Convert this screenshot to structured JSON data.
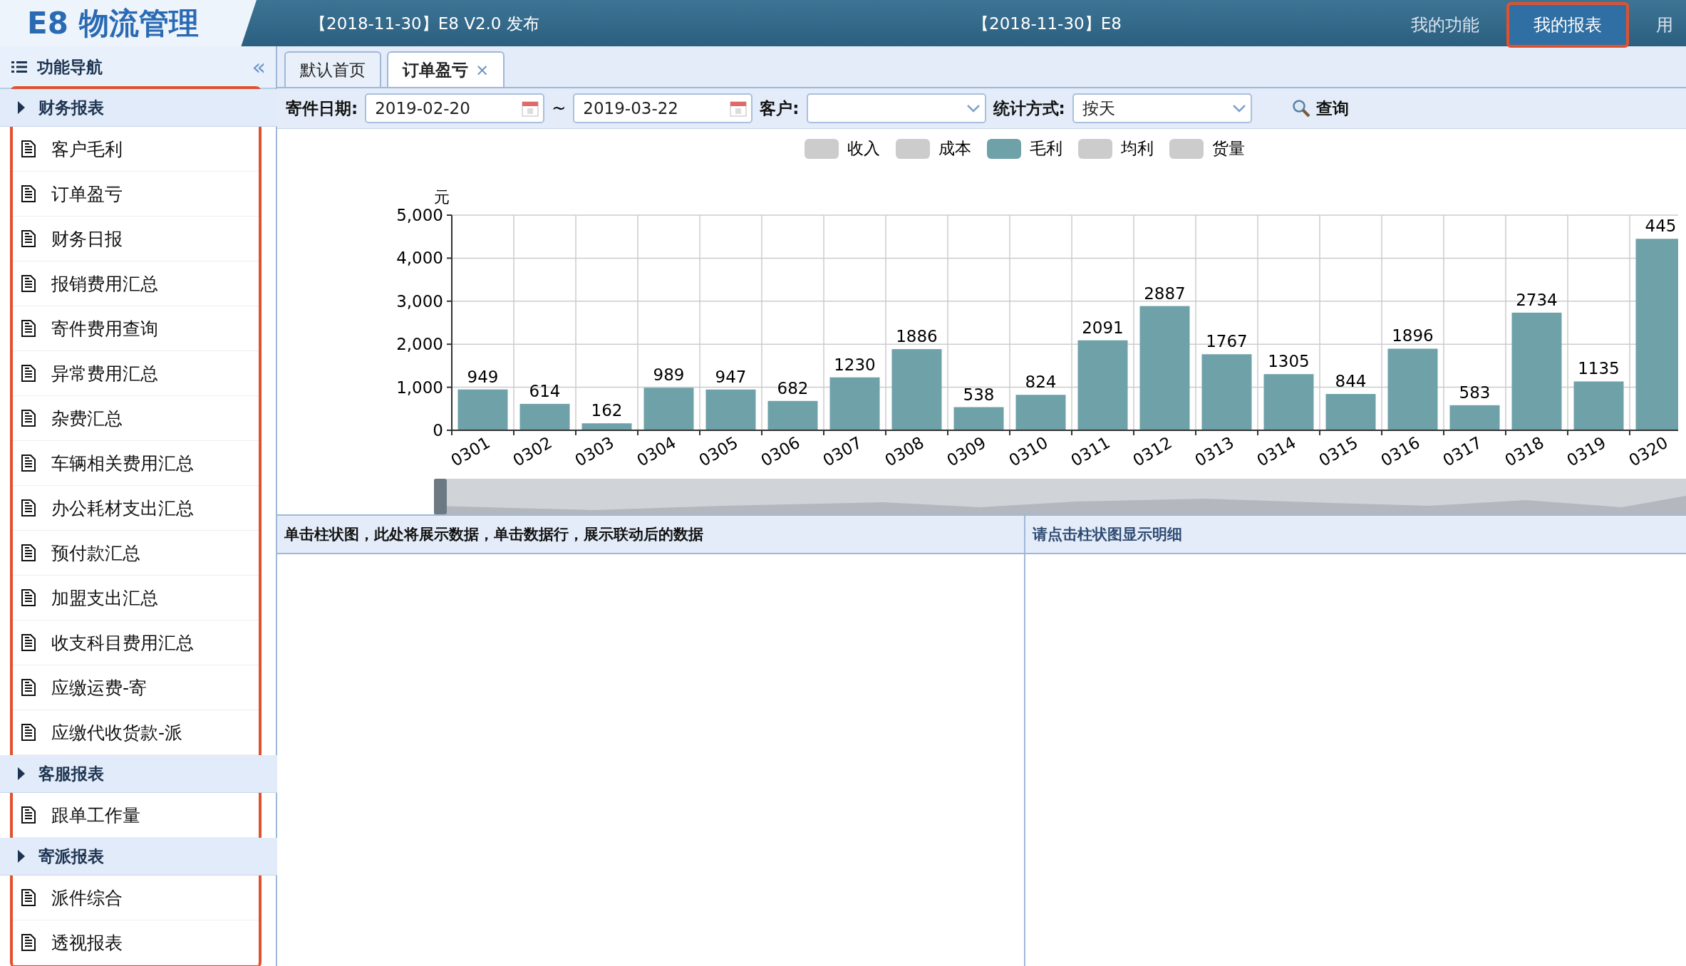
{
  "header": {
    "logo": "E8 物流管理",
    "news": [
      "【2018-11-30】E8 V2.0 发布",
      "【2018-11-30】E8"
    ],
    "nav": [
      {
        "label": "我的功能",
        "highlighted": false
      },
      {
        "label": "我的报表",
        "highlighted": true
      },
      {
        "label": "用",
        "highlighted": false
      }
    ]
  },
  "sidebar": {
    "title": "功能导航",
    "collapse": "«",
    "highlighted": true,
    "groups": [
      {
        "title": "财务报表",
        "items": [
          "客户毛利",
          "订单盈亏",
          "财务日报",
          "报销费用汇总",
          "寄件费用查询",
          "异常费用汇总",
          "杂费汇总",
          "车辆相关费用汇总",
          "办公耗材支出汇总",
          "预付款汇总",
          "加盟支出汇总",
          "收支科目费用汇总",
          "应缴运费-寄",
          "应缴代收货款-派"
        ]
      },
      {
        "title": "客服报表",
        "items": [
          "跟单工作量"
        ]
      },
      {
        "title": "寄派报表",
        "items": [
          "派件综合",
          "透视报表"
        ]
      }
    ]
  },
  "tabs": [
    {
      "label": "默认首页",
      "selected": false
    },
    {
      "label": "订单盈亏",
      "selected": true,
      "close_icon": "×"
    }
  ],
  "filters": {
    "date_label": "寄件日期:",
    "date_from": "2019-02-20",
    "separator": "~",
    "date_to": "2019-03-22",
    "customer_label": "客户:",
    "mode_label": "统计方式:",
    "mode_value": "按天",
    "query_button": "查询"
  },
  "legend": [
    {
      "label": "收入",
      "selected": false
    },
    {
      "label": "成本",
      "selected": false
    },
    {
      "kind": "series",
      "selected": true
    },
    {
      "label": "均利",
      "selected": false
    },
    {
      "label": "货量",
      "selected": false
    }
  ],
  "chart": {
    "chart_data": {
      "type": "bar",
      "ylabel": "元",
      "categories": [
        "0301",
        "0302",
        "0303",
        "0304",
        "0305",
        "0306",
        "0307",
        "0308",
        "0309",
        "0310",
        "0311",
        "0312",
        "0313",
        "0314",
        "0315",
        "0316",
        "0317",
        "0318",
        "0319",
        "0320"
      ],
      "series": [
        {
          "name": "毛利",
          "color": "#6fa1a8",
          "values": [
            949,
            614,
            162,
            989,
            947,
            682,
            1230,
            1886,
            538,
            824,
            2091,
            2887,
            1767,
            1305,
            844,
            1896,
            583,
            2734,
            1135,
            4450
          ]
        }
      ],
      "ylim": [
        0,
        5000
      ],
      "grid": true,
      "yticks": [
        {
          "value": 0,
          "label": "0"
        },
        {
          "value": 1000,
          "label": "1,000"
        },
        {
          "value": 2000,
          "label": "2,000"
        },
        {
          "value": 3000,
          "label": "3,000"
        },
        {
          "value": 4000,
          "label": "4,000"
        },
        {
          "value": 5000,
          "label": "5,000"
        }
      ],
      "value_labels": [
        "949",
        "614",
        "162",
        "989",
        "947",
        "682",
        "1230",
        "1886",
        "538",
        "824",
        "2091",
        "2887",
        "1767",
        "1305",
        "844",
        "1896",
        "583",
        "2734",
        "1135",
        "445"
      ]
    }
  },
  "zoom": {
    "level": 1
  },
  "detail": {
    "left_title": "单击柱状图，此处将展示数据，单击数据行，展示联动后的数据",
    "right_title": "请点击柱状图显示明细"
  }
}
